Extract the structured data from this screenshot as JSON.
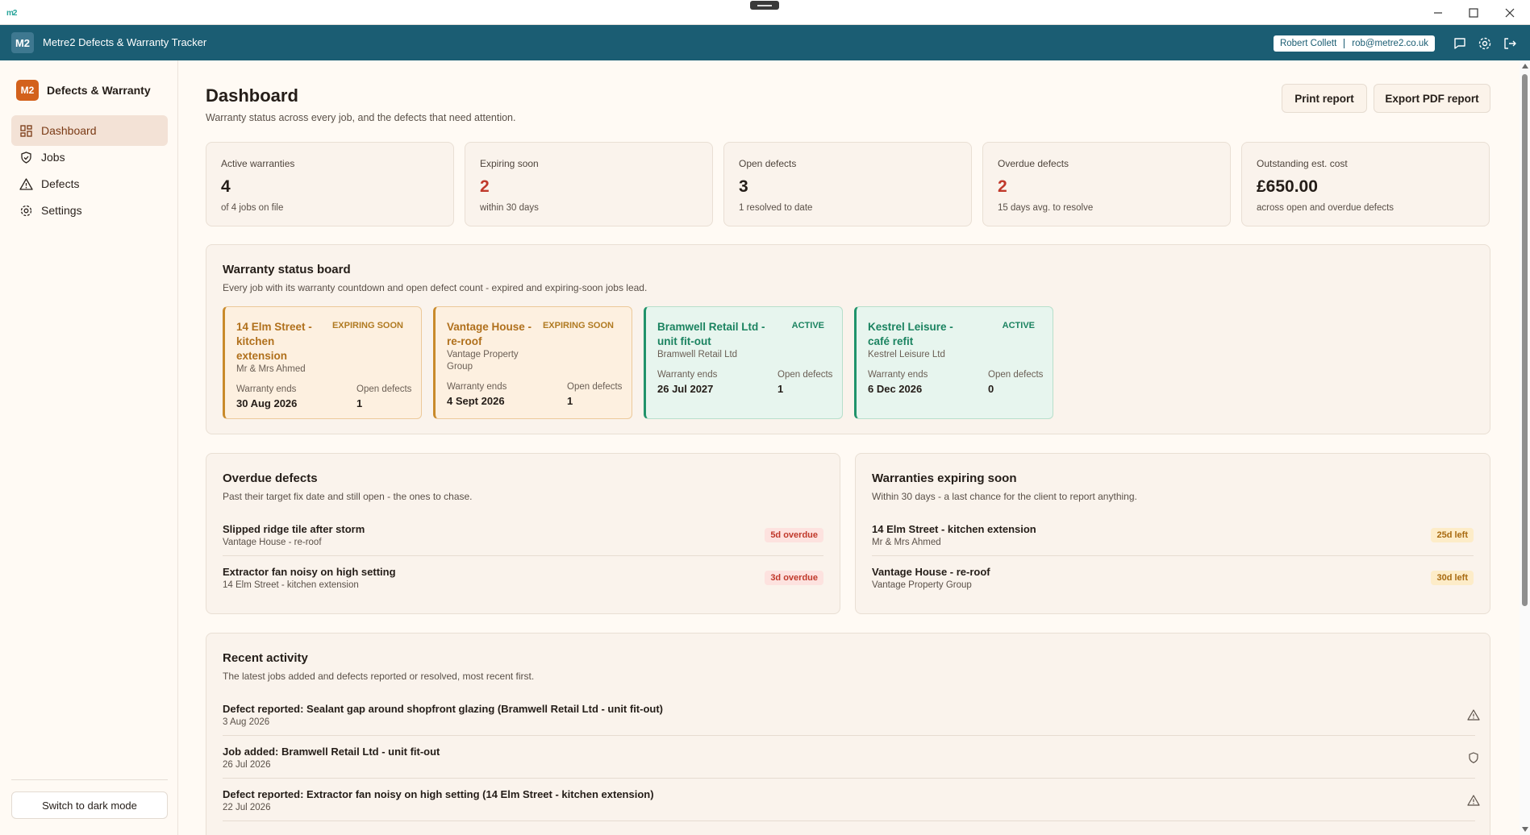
{
  "os": {
    "app_logo": "m2"
  },
  "header": {
    "badge": "M2",
    "title": "Metre2 Defects & Warranty Tracker",
    "user_name": "Robert Collett",
    "user_email": "rob@metre2.co.uk"
  },
  "sidebar": {
    "brand_badge": "M2",
    "brand_title": "Defects & Warranty",
    "items": [
      {
        "label": "Dashboard",
        "icon": "dashboard-icon",
        "active": true
      },
      {
        "label": "Jobs",
        "icon": "shield-icon"
      },
      {
        "label": "Defects",
        "icon": "warning-icon"
      },
      {
        "label": "Settings",
        "icon": "gear-icon"
      }
    ],
    "dark_mode_label": "Switch to dark mode"
  },
  "page": {
    "title": "Dashboard",
    "subtitle": "Warranty status across every job, and the defects that need attention.",
    "print_label": "Print report",
    "export_label": "Export PDF report"
  },
  "stats": [
    {
      "label": "Active warranties",
      "value": "4",
      "detail": "of 4 jobs on file",
      "color": "#241d18"
    },
    {
      "label": "Expiring soon",
      "value": "2",
      "detail": "within 30 days",
      "color": "#c0392b"
    },
    {
      "label": "Open defects",
      "value": "3",
      "detail": "1 resolved to date",
      "color": "#241d18"
    },
    {
      "label": "Overdue defects",
      "value": "2",
      "detail": "15 days avg. to resolve",
      "color": "#c0392b"
    },
    {
      "label": "Outstanding est. cost",
      "value": "£650.00",
      "detail": "across open and overdue defects",
      "color": "#241d18"
    }
  ],
  "board": {
    "title": "Warranty status board",
    "subtitle": "Every job with its warranty countdown and open defect count - expired and expiring-soon jobs lead.",
    "ends_label": "Warranty ends",
    "open_label": "Open defects",
    "cards": [
      {
        "name": "14 Elm Street - kitchen extension",
        "status": "EXPIRING SOON",
        "client": "Mr & Mrs Ahmed",
        "ends": "30 Aug 2026",
        "open": "1"
      },
      {
        "name": "Vantage House - re-roof",
        "status": "EXPIRING SOON",
        "client": "Vantage Property Group",
        "ends": "4 Sept 2026",
        "open": "1"
      },
      {
        "name": "Bramwell Retail Ltd - unit fit-out",
        "status": "ACTIVE",
        "client": "Bramwell Retail Ltd",
        "ends": "26 Jul 2027",
        "open": "1"
      },
      {
        "name": "Kestrel Leisure - café refit",
        "status": "ACTIVE",
        "client": "Kestrel Leisure Ltd",
        "ends": "6 Dec 2026",
        "open": "0"
      }
    ]
  },
  "overdue": {
    "title": "Overdue defects",
    "subtitle": "Past their target fix date and still open - the ones to chase.",
    "items": [
      {
        "title": "Slipped ridge tile after storm",
        "job": "Vantage House - re-roof",
        "badge": "5d overdue"
      },
      {
        "title": "Extractor fan noisy on high setting",
        "job": "14 Elm Street - kitchen extension",
        "badge": "3d overdue"
      }
    ]
  },
  "expiring": {
    "title": "Warranties expiring soon",
    "subtitle": "Within 30 days - a last chance for the client to report anything.",
    "items": [
      {
        "title": "14 Elm Street - kitchen extension",
        "client": "Mr & Mrs Ahmed",
        "badge": "25d left"
      },
      {
        "title": "Vantage House - re-roof",
        "client": "Vantage Property Group",
        "badge": "30d left"
      }
    ]
  },
  "activity": {
    "title": "Recent activity",
    "subtitle": "The latest jobs added and defects reported or resolved, most recent first.",
    "items": [
      {
        "text": "Defect reported: Sealant gap around shopfront glazing (Bramwell Retail Ltd - unit fit-out)",
        "date": "3 Aug 2026",
        "icon": "warning-icon"
      },
      {
        "text": "Job added: Bramwell Retail Ltd - unit fit-out",
        "date": "26 Jul 2026",
        "icon": "shield-icon"
      },
      {
        "text": "Defect reported: Extractor fan noisy on high setting (14 Elm Street - kitchen extension)",
        "date": "22 Jul 2026",
        "icon": "warning-icon"
      }
    ]
  }
}
